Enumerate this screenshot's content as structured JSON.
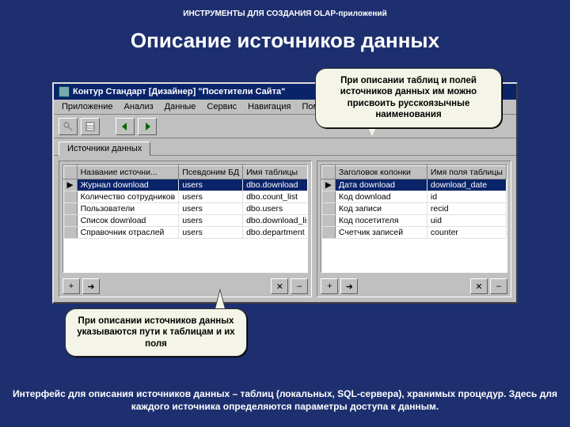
{
  "breadcrumb": "ИНСТРУМЕНТЫ ДЛЯ СОЗДАНИЯ OLAP-приложений",
  "title": "Описание источников данных",
  "window": {
    "title": "Контур Стандарт [Дизайнер] \"Посетители Сайта\"",
    "menus": [
      "Приложение",
      "Анализ",
      "Данные",
      "Сервис",
      "Навигация",
      "Помощь"
    ],
    "tab": "Источники данных"
  },
  "left_grid": {
    "headers": [
      "",
      "Название источни...",
      "Псевдоним БД",
      "Имя таблицы"
    ],
    "rows": [
      [
        "▶",
        "Журнал download",
        "users",
        "dbo.download"
      ],
      [
        "",
        "Количество сотрудников",
        "users",
        "dbo.count_list"
      ],
      [
        "",
        "Пользователи",
        "users",
        "dbo.users"
      ],
      [
        "",
        "Список download",
        "users",
        "dbo.download_list"
      ],
      [
        "",
        "Справочник отраслей",
        "users",
        "dbo.department"
      ]
    ]
  },
  "right_grid": {
    "headers": [
      "",
      "Заголовок колонки",
      "Имя поля таблицы"
    ],
    "rows": [
      [
        "▶",
        "Дата download",
        "download_date"
      ],
      [
        "",
        "Код download",
        "id"
      ],
      [
        "",
        "Код записи",
        "recid"
      ],
      [
        "",
        "Код посетителя",
        "uid"
      ],
      [
        "",
        "Счетчик записей",
        "counter"
      ]
    ]
  },
  "panel_buttons": [
    "+",
    "➜",
    "✕",
    "–"
  ],
  "callouts": {
    "c1": "При описании таблиц и полей источников данных им можно присвоить русскоязычные наименования",
    "c2": "При описании источников данных указываются пути к таблицам и их поля"
  },
  "footer": "Интерфейс для описания источников данных – таблиц (локальных, SQL-сервера), хранимых процедур. Здесь для каждого источника определяются параметры доступа к данным."
}
